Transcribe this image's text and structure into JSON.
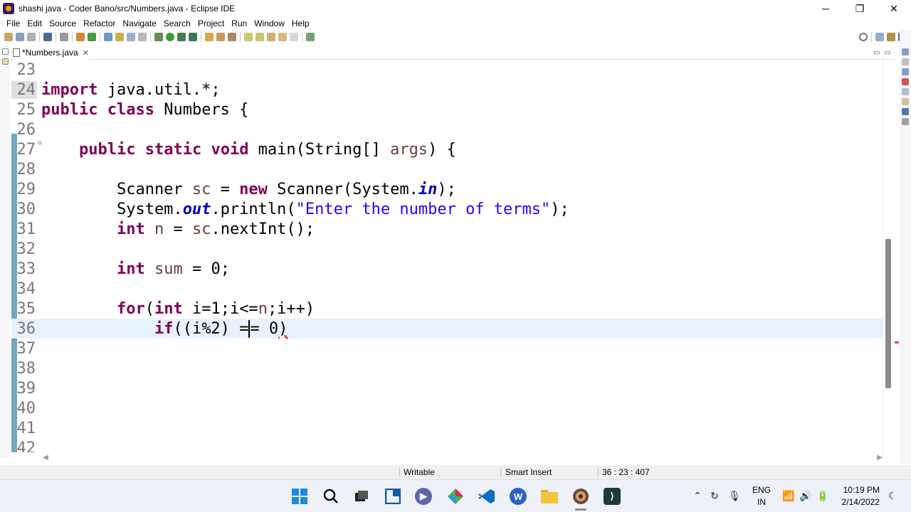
{
  "window": {
    "title": "shashi java - Coder Bano/src/Numbers.java - Eclipse IDE",
    "minimize": "─",
    "maximize": "❐",
    "close": "✕"
  },
  "menu": [
    "File",
    "Edit",
    "Source",
    "Refactor",
    "Navigate",
    "Search",
    "Project",
    "Run",
    "Window",
    "Help"
  ],
  "editor": {
    "tab_label": "*Numbers.java",
    "tab_close": "✕",
    "tab_minimize": "▭",
    "tab_maximize": "▭",
    "lines": [
      {
        "n": "23",
        "code": ""
      },
      {
        "n": "24",
        "code": "import java.util.*;"
      },
      {
        "n": "25",
        "code": "public class Numbers {"
      },
      {
        "n": "26",
        "code": ""
      },
      {
        "n": "27",
        "code": "    public static void main(String[] args) {"
      },
      {
        "n": "28",
        "code": ""
      },
      {
        "n": "29",
        "code": "        Scanner sc = new Scanner(System.in);"
      },
      {
        "n": "30",
        "code": "        System.out.println(\"Enter the number of terms\");"
      },
      {
        "n": "31",
        "code": "        int n = sc.nextInt();"
      },
      {
        "n": "32",
        "code": ""
      },
      {
        "n": "33",
        "code": "        int sum = 0;"
      },
      {
        "n": "34",
        "code": ""
      },
      {
        "n": "35",
        "code": "        for(int i=1;i<=n;i++)"
      },
      {
        "n": "36",
        "code": "            if((i%2) == 0)"
      },
      {
        "n": "37",
        "code": ""
      },
      {
        "n": "38",
        "code": ""
      },
      {
        "n": "39",
        "code": ""
      },
      {
        "n": "40",
        "code": ""
      },
      {
        "n": "41",
        "code": ""
      },
      {
        "n": "42",
        "code": ""
      }
    ],
    "current_line": "36",
    "error_line": "36",
    "fold_marker": "⊖"
  },
  "status": {
    "writable": "Writable",
    "insert_mode": "Smart Insert",
    "position": "36 : 23 : 407"
  },
  "taskbar": {
    "apps": [
      "windows-start",
      "search",
      "file-manager",
      "snap-layout",
      "teams-chat",
      "ms-store",
      "vscode",
      "wps-office",
      "file-explorer",
      "eclipse-ide",
      "terminal"
    ],
    "lang_line1": "ENG",
    "lang_line2": "IN",
    "time": "10:19 PM",
    "date": "2/14/2022"
  },
  "colors": {
    "keyword": "#7f0055",
    "string": "#2a00ff",
    "static_field": "#0000c0",
    "local_variable": "#6a3e3e",
    "current_line_bg": "#e8f2fe",
    "quick_diff": "#6fa8c0"
  }
}
